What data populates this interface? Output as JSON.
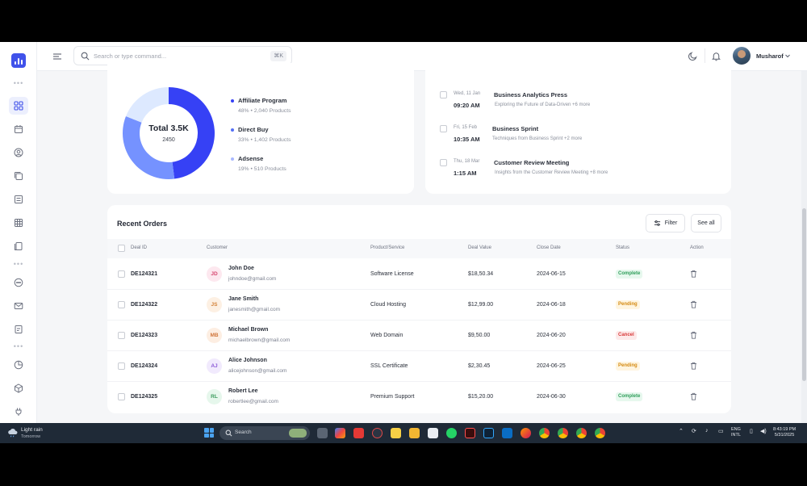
{
  "header": {
    "search_placeholder": "Search or type command...",
    "shortcut": "⌘K",
    "user_name": "Musharof"
  },
  "donut": {
    "total_label": "Total 3.5K",
    "total_sub": "2450",
    "segments": [
      {
        "name": "Affiliate Program",
        "percent": 48,
        "meta": "48%  •  2,040 Products",
        "color": "#3641f5"
      },
      {
        "name": "Direct Buy",
        "percent": 33,
        "meta": "33%  •  1,402 Products",
        "color": "#7592ff"
      },
      {
        "name": "Adsense",
        "percent": 19,
        "meta": "19%  •  510 Products",
        "color": "#dde9ff"
      }
    ]
  },
  "events": [
    {
      "date": "Wed, 11 Jan",
      "time": "09:20 AM",
      "title": "Business Analytics Press",
      "desc": "Exploring the Future of Data-Driven +6 more"
    },
    {
      "date": "Fri, 15 Feb",
      "time": "10:35 AM",
      "title": "Business Sprint",
      "desc": "Techniques from Business Sprint +2 more"
    },
    {
      "date": "Thu, 18 Mar",
      "time": "1:15 AM",
      "title": "Customer Review Meeting",
      "desc": "Insights from the Customer Review Meeting +8 more"
    }
  ],
  "orders": {
    "title": "Recent Orders",
    "filter_label": "Filter",
    "see_all_label": "See all",
    "columns": [
      "Deal ID",
      "Customer",
      "Product/Service",
      "Deal Value",
      "Close Date",
      "Status",
      "Action"
    ],
    "rows": [
      {
        "id": "DE124321",
        "initials": "JD",
        "name": "John Doe",
        "email": "johndoe@gmail.com",
        "product": "Software License",
        "value": "$18,50.34",
        "date": "2024-06-15",
        "status": "Complete",
        "av_bg": "#fde8ef",
        "av_fg": "#d6456f"
      },
      {
        "id": "DE124322",
        "initials": "JS",
        "name": "Jane Smith",
        "email": "janesmith@gmail.com",
        "product": "Cloud Hosting",
        "value": "$12,99.00",
        "date": "2024-06-18",
        "status": "Pending",
        "av_bg": "#fdf0e3",
        "av_fg": "#d3823a"
      },
      {
        "id": "DE124323",
        "initials": "MB",
        "name": "Michael Brown",
        "email": "michaelbrown@gmail.com",
        "product": "Web Domain",
        "value": "$9,50.00",
        "date": "2024-06-20",
        "status": "Cancel",
        "av_bg": "#fdeee2",
        "av_fg": "#d0763b"
      },
      {
        "id": "DE124324",
        "initials": "AJ",
        "name": "Alice Johnson",
        "email": "alicejohnson@gmail.com",
        "product": "SSL Certificate",
        "value": "$2,30.45",
        "date": "2024-06-25",
        "status": "Pending",
        "av_bg": "#f1eafd",
        "av_fg": "#8b5ad6"
      },
      {
        "id": "DE124325",
        "initials": "RL",
        "name": "Robert Lee",
        "email": "robertlee@gmail.com",
        "product": "Premium Support",
        "value": "$15,20.00",
        "date": "2024-06-30",
        "status": "Complete",
        "av_bg": "#e6f7ec",
        "av_fg": "#3a9b5c"
      }
    ]
  },
  "status_colors": {
    "Complete": {
      "bg": "#e7f8ee",
      "fg": "#2f9e5a"
    },
    "Pending": {
      "bg": "#fff5e0",
      "fg": "#d48a12"
    },
    "Cancel": {
      "bg": "#fdeaea",
      "fg": "#d93b3b"
    }
  },
  "taskbar": {
    "weather_title": "Light rain",
    "weather_sub": "Tomorrow",
    "search_label": "Search",
    "lang_1": "ENG",
    "lang_2": "INTL",
    "time": "8:43:19 PM",
    "date": "5/31/2025"
  }
}
